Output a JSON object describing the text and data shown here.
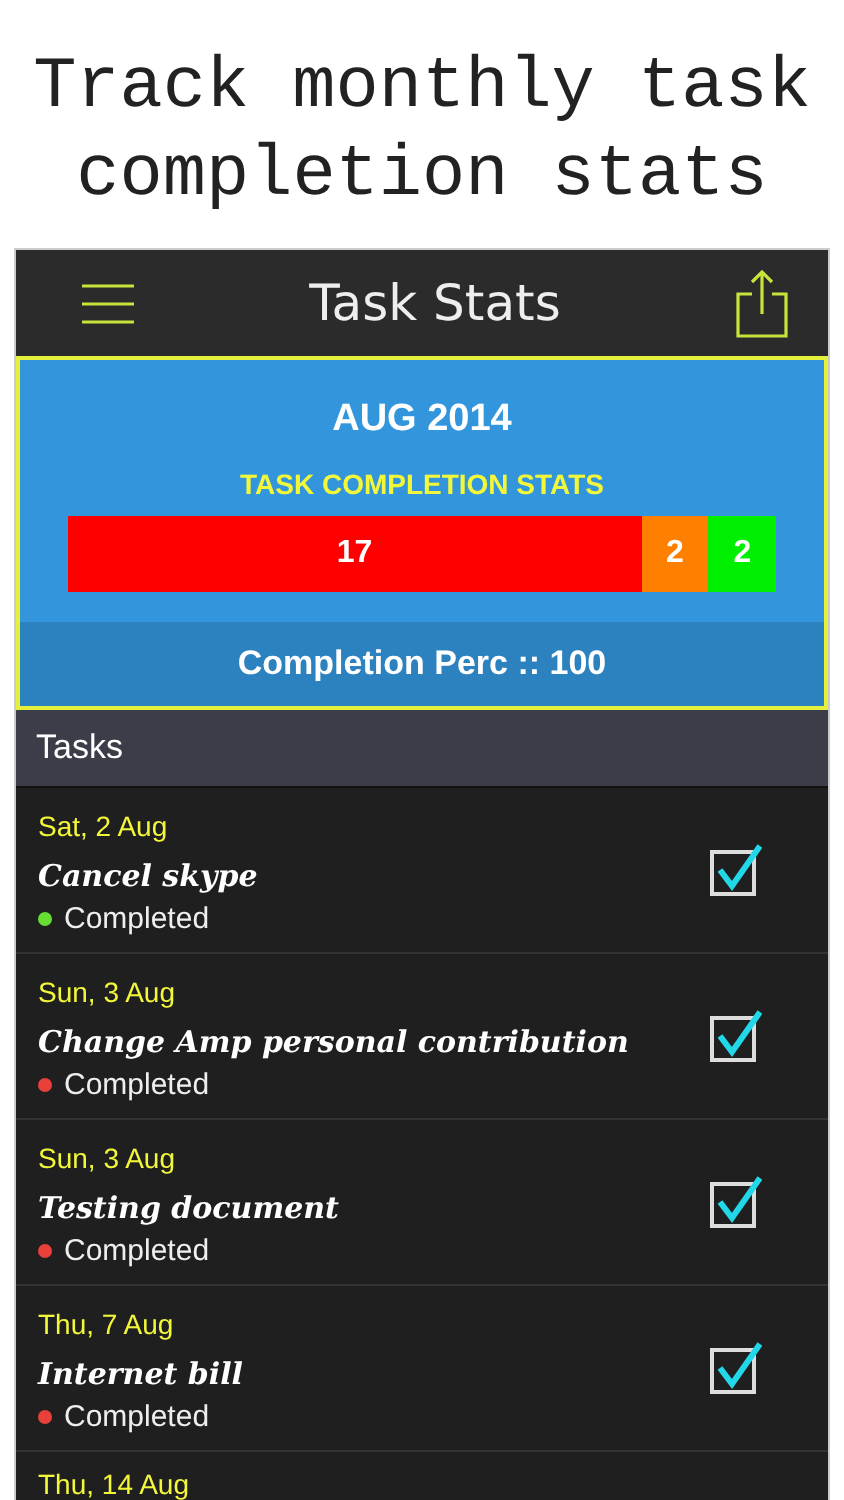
{
  "caption": [
    "Track monthly task",
    "completion stats"
  ],
  "nav_bar": {
    "title": "Task Stats"
  },
  "stats": {
    "month": "AUG 2014",
    "subtitle": "TASK COMPLETION STATS",
    "segments": [
      {
        "value": "17",
        "color": "#ff0000"
      },
      {
        "value": "2",
        "color": "#ff7f00"
      },
      {
        "value": "2",
        "color": "#00ee00"
      }
    ],
    "footer": "Completion Perc :: 100"
  },
  "tasks_header": "Tasks",
  "tasks": [
    {
      "date": "Sat, 2 Aug",
      "title": "Cancel skype",
      "status": "Completed",
      "color": "#66dd33",
      "checked": true
    },
    {
      "date": "Sun, 3 Aug",
      "title": "Change Amp personal contribution",
      "status": "Completed",
      "color": "#e8403a",
      "checked": true
    },
    {
      "date": "Sun, 3 Aug",
      "title": "Testing document",
      "status": "Completed",
      "color": "#e8403a",
      "checked": true
    },
    {
      "date": "Thu, 7 Aug",
      "title": "Internet bill",
      "status": "Completed",
      "color": "#e8403a",
      "checked": true
    },
    {
      "date": "Thu, 14 Aug"
    }
  ]
}
